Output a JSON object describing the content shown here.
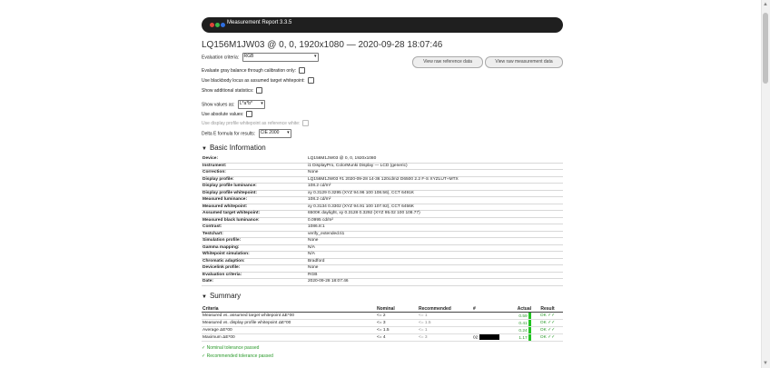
{
  "window": {
    "title": "Measurement Report 3.3.5",
    "dot_colors": [
      "#e0443a",
      "#3ab54a",
      "#2e6fe0"
    ]
  },
  "heading": "LQ156M1JW03 @ 0, 0, 1920x1080 — 2020-09-28 18:07:46",
  "options": {
    "evaluation_criteria_label": "Evaluation criteria:",
    "evaluation_criteria_value": "RGB",
    "gray_balance_label": "Evaluate gray balance through calibration only:",
    "blackbody_label": "Use blackbody locus as assumed target whitepoint:",
    "additional_stats_label": "Show additional statistics:",
    "show_values_label": "Show values as:",
    "show_values_value": "L*a*b*",
    "absolute_values_label": "Use absolute values:",
    "display_profile_wp_label": "Use display profile whitepoint as reference white:",
    "delta_e_label": "Delta E formula for results:",
    "delta_e_value": "CIE 2000"
  },
  "buttons": {
    "raw_reference": "View raw reference data",
    "raw_measurement": "View raw measurement data"
  },
  "basic_info": {
    "title": "Basic Information",
    "rows": [
      {
        "k": "Device:",
        "v": "LQ156M1JW03 @ 0, 0, 1920x1080"
      },
      {
        "k": "Instrument:",
        "v": "i1 DisplayPro, ColorMunki Display — LCD (generic)"
      },
      {
        "k": "Correction:",
        "v": "None"
      },
      {
        "k": "Display profile:",
        "v": "LQ156M1JW03 #1 2020-09-28 14-36 120cdm2 D6500 2.2 F-S XYZLUT+MTX"
      },
      {
        "k": "Display profile luminance:",
        "v": "108.2 cd/m²"
      },
      {
        "k": "Display profile whitepoint:",
        "v": "xy 0.3129 0.3295 (XYZ 94.96 100 108.56), CCT 6491K"
      },
      {
        "k": "Measured luminance:",
        "v": "108.2 cd/m²"
      },
      {
        "k": "Measured whitepoint:",
        "v": "xy 0.3134 0.3302 (XYZ 94.91 100 107.92), CCT 6456K"
      },
      {
        "k": "Assumed target whitepoint:",
        "v": "6500K daylight, xy 0.3128 0.3292 (XYZ 95.02 100 108.77)"
      },
      {
        "k": "Measured black luminance:",
        "v": "0.0995 cd/m²"
      },
      {
        "k": "Contrast:",
        "v": "1086.8:1"
      },
      {
        "k": "Testchart:",
        "v": "verify_extended.ti1"
      },
      {
        "k": "Simulation profile:",
        "v": "None"
      },
      {
        "k": "Gamma mapping:",
        "v": "N/A"
      },
      {
        "k": "Whitepoint simulation:",
        "v": "N/A"
      },
      {
        "k": "Chromatic adaption:",
        "v": "Bradford"
      },
      {
        "k": "Devicelink profile:",
        "v": "None"
      },
      {
        "k": "Evaluation criteria:",
        "v": "RGB"
      },
      {
        "k": "Date:",
        "v": "2020-09-28 18:07:46"
      }
    ]
  },
  "summary": {
    "title": "Summary",
    "headers": [
      "Criteria",
      "Nominal",
      "Recommended",
      "#",
      "Actual",
      "Result"
    ],
    "rows": [
      {
        "criteria": "Measured vs. assumed target whitepoint ΔE*00",
        "nominal": "<= 2",
        "recommended": "<= 1",
        "num": "",
        "swatch": false,
        "actual": "0.59",
        "result": "OK ✓✓"
      },
      {
        "criteria": "Measured vs. display profile whitepoint ΔE*00",
        "nominal": "<= 3",
        "recommended": "<= 1.5",
        "num": "",
        "swatch": false,
        "actual": "0.41",
        "result": "OK ✓✓"
      },
      {
        "criteria": "Average ΔE*00",
        "nominal": "<= 1.5",
        "recommended": "<= 1",
        "num": "",
        "swatch": false,
        "actual": "0.24",
        "result": "OK ✓✓"
      },
      {
        "criteria": "Maximum ΔE*00",
        "nominal": "<= 4",
        "recommended": "<= 3",
        "num": "02",
        "swatch": true,
        "actual": "1.17",
        "result": "OK ✓✓"
      }
    ]
  },
  "legend": {
    "nominal": "✓ Nominal tolerance passed",
    "recommended": "✓ Recommended tolerance passed"
  },
  "colors": {
    "ok_green": "#2a9a2a",
    "bar_green": "#22c322"
  }
}
